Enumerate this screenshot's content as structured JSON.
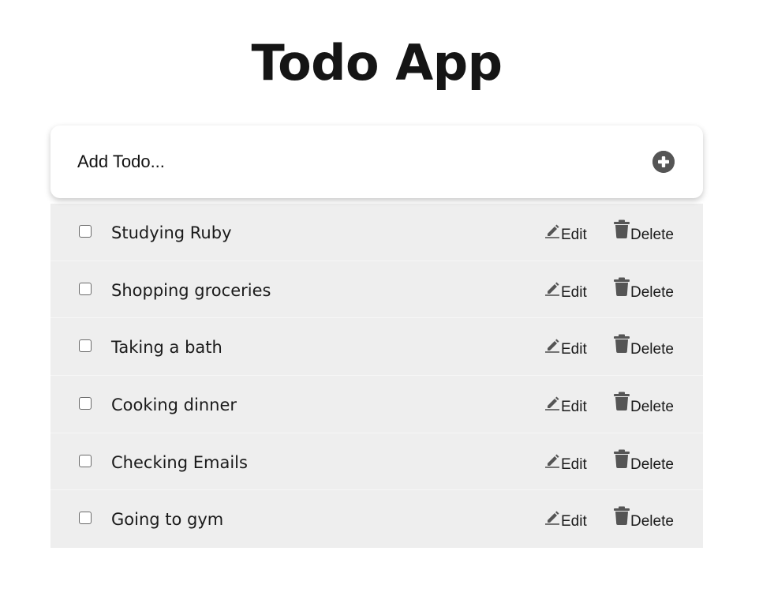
{
  "app": {
    "title": "Todo App"
  },
  "add_todo": {
    "placeholder": "Add Todo...",
    "value": "",
    "button_icon": "plus-circle-icon"
  },
  "todos": [
    {
      "text": "Studying Ruby",
      "checked": false,
      "edit_label": "Edit",
      "delete_label": "Delete"
    },
    {
      "text": "Shopping groceries",
      "checked": false,
      "edit_label": "Edit",
      "delete_label": "Delete"
    },
    {
      "text": "Taking a bath",
      "checked": false,
      "edit_label": "Edit",
      "delete_label": "Delete"
    },
    {
      "text": "Cooking dinner",
      "checked": false,
      "edit_label": "Edit",
      "delete_label": "Delete"
    },
    {
      "text": "Checking Emails",
      "checked": false,
      "edit_label": "Edit",
      "delete_label": "Delete"
    },
    {
      "text": "Going to gym",
      "checked": false,
      "edit_label": "Edit",
      "delete_label": "Delete"
    }
  ],
  "icons": {
    "edit": "pencil-icon",
    "delete": "trash-icon"
  },
  "colors": {
    "title": "#151515",
    "icon": "#555555",
    "list_background": "#eeeeee",
    "card_background": "#ffffff"
  }
}
